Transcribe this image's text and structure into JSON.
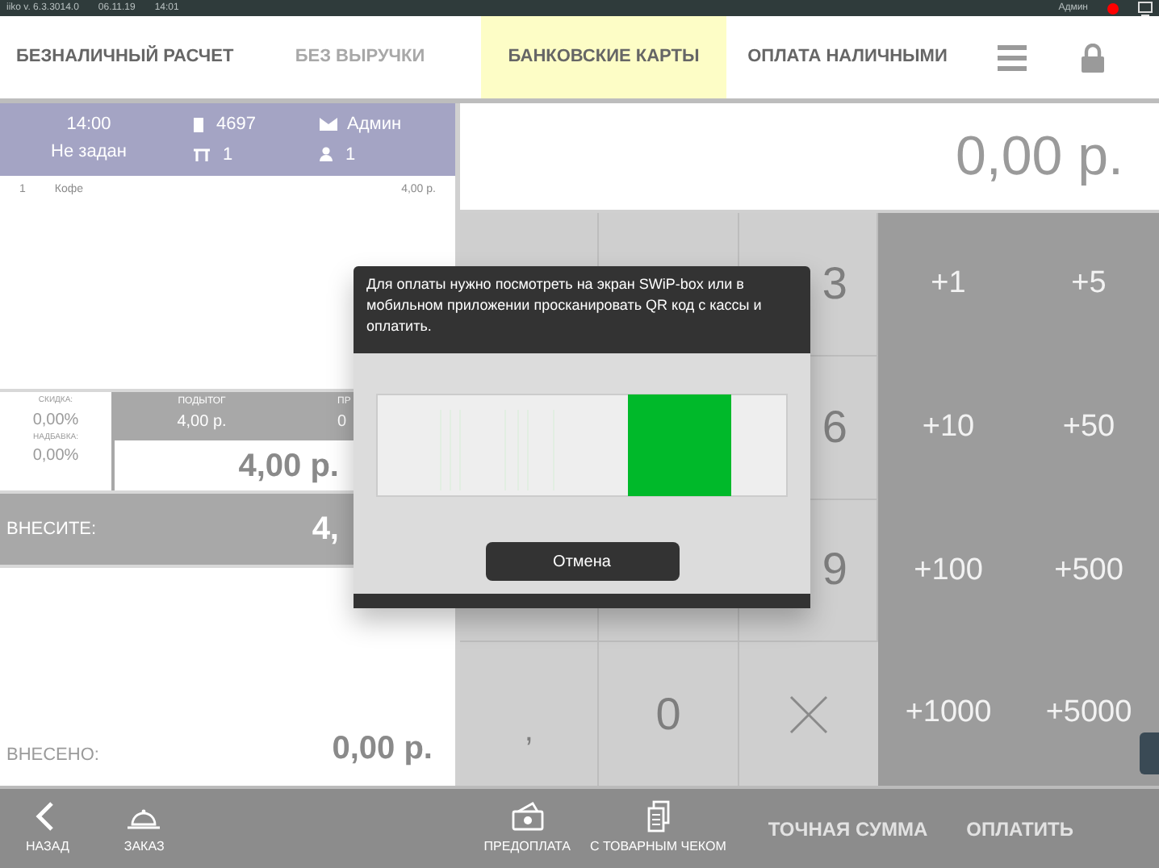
{
  "status_bar": {
    "version": "iiko  v. 6.3.3014.0",
    "date": "06.11.19",
    "time": "14:01",
    "user": "Админ",
    "online": true
  },
  "tabs": [
    {
      "label": "БЕЗНАЛИЧНЫЙ РАСЧЕТ",
      "selected": false,
      "disabled": false
    },
    {
      "label": "БЕЗ ВЫРУЧКИ",
      "selected": false,
      "disabled": true
    },
    {
      "label": "БАНКОВСКИЕ КАРТЫ",
      "selected": true,
      "disabled": false
    },
    {
      "label": "ОПЛАТА НАЛИЧНЫМИ",
      "selected": false,
      "disabled": false
    }
  ],
  "order": {
    "time": "14:00",
    "client": "Не задан",
    "number": "4697",
    "table": "1",
    "waiter": "Админ",
    "guests": "1"
  },
  "items": [
    {
      "qty": "1",
      "name": "Кофе",
      "price": "4,00 р."
    }
  ],
  "summary": {
    "discount_label": "СКИДКА:",
    "discount": "0,00%",
    "surcharge_label": "НАДБАВКА:",
    "surcharge": "0,00%",
    "subtotal_label": "ПОДЫТОГ",
    "subtotal": "4,00 р.",
    "column_3_label": "ПР",
    "column_3_value": "0",
    "total": "4,00 р."
  },
  "due": {
    "label": "ВНЕСИТЕ:",
    "amount": "4,"
  },
  "paid": {
    "label": "ВНЕСЕНО:",
    "amount": "0,00 р."
  },
  "display": "0,00 р.",
  "keypad": {
    "right_column": [
      "3",
      "6",
      "9"
    ],
    "bottom_row": [
      ",",
      "0"
    ],
    "quick_amounts": [
      "+1",
      "+5",
      "+10",
      "+50",
      "+100",
      "+500",
      "+1000",
      "+5000"
    ]
  },
  "dialog": {
    "message": "Для оплаты нужно посмотреть на экран SWiP-box или в мобильном приложении просканировать QR код с кассы и оплатить.",
    "cancel": "Отмена"
  },
  "bottom_bar": [
    {
      "label": "НАЗАД",
      "kind": "back",
      "disabled": false
    },
    {
      "label": "ЗАКАЗ",
      "kind": "order",
      "disabled": false
    },
    {
      "label": "ПРЕДОПЛАТА",
      "kind": "prepay",
      "disabled": false
    },
    {
      "label": "С ТОВАРНЫМ ЧЕКОМ",
      "kind": "receipt",
      "disabled": false
    },
    {
      "label": "ТОЧНАЯ СУММА",
      "kind": "text",
      "disabled": true
    },
    {
      "label": "ОПЛАТИТЬ",
      "kind": "text",
      "disabled": true
    }
  ]
}
